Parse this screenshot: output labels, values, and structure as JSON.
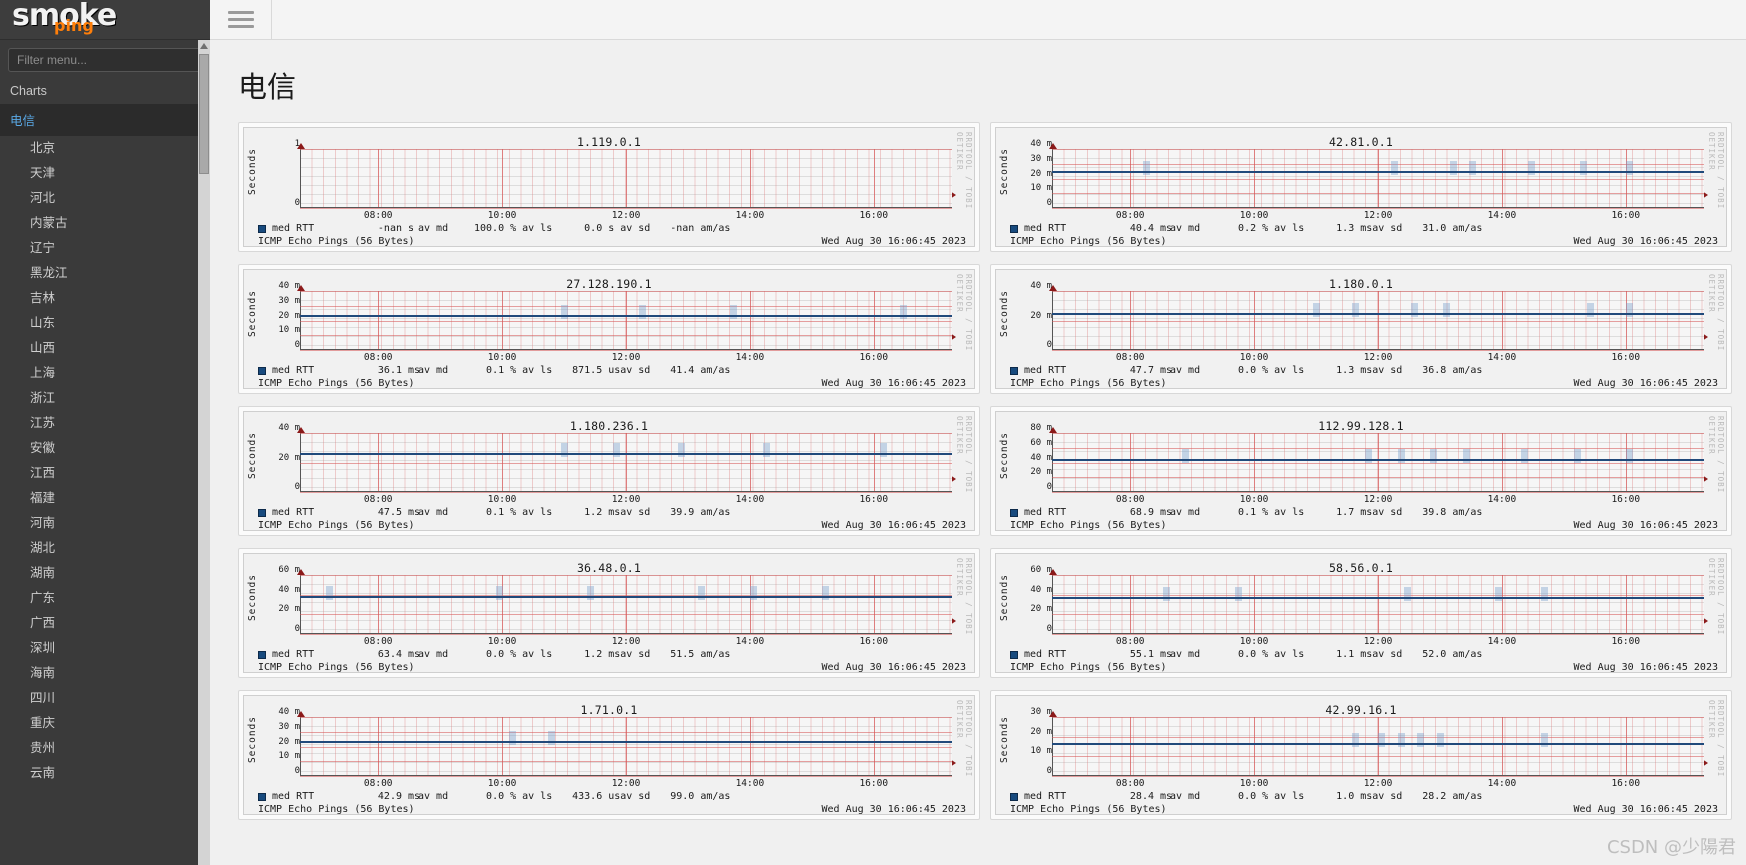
{
  "brand": {
    "smoke": "smoke",
    "ping": "ping"
  },
  "sidebar": {
    "filter_placeholder": "Filter menu...",
    "section_label": "Charts",
    "root_label": "电信",
    "items": [
      {
        "label": "北京"
      },
      {
        "label": "天津"
      },
      {
        "label": "河北"
      },
      {
        "label": "内蒙古"
      },
      {
        "label": "辽宁"
      },
      {
        "label": "黑龙江"
      },
      {
        "label": "吉林"
      },
      {
        "label": "山东"
      },
      {
        "label": "山西"
      },
      {
        "label": "上海"
      },
      {
        "label": "浙江"
      },
      {
        "label": "江苏"
      },
      {
        "label": "安徽"
      },
      {
        "label": "江西"
      },
      {
        "label": "福建"
      },
      {
        "label": "河南"
      },
      {
        "label": "湖北"
      },
      {
        "label": "湖南"
      },
      {
        "label": "广东"
      },
      {
        "label": "广西"
      },
      {
        "label": "深圳"
      },
      {
        "label": "海南"
      },
      {
        "label": "四川"
      },
      {
        "label": "重庆"
      },
      {
        "label": "贵州"
      },
      {
        "label": "云南"
      }
    ]
  },
  "topbar": {
    "menu_icon": "hamburger-icon"
  },
  "page": {
    "title": "电信"
  },
  "common": {
    "yaxis_label": "Seconds",
    "watermark": "RRDTOOL / TOBI OETIKER",
    "xticks": [
      "08:00",
      "10:00",
      "12:00",
      "14:00",
      "16:00"
    ],
    "probe": "ICMP Echo Pings (56 Bytes)",
    "timestamp": "Wed Aug 30 16:06:45 2023",
    "legend_name": "med RTT",
    "legend_med_unit": "av md",
    "legend_loss_unit": "av ls",
    "legend_sd_unit": "av sd",
    "legend_am_unit": "am/as",
    "accent": "#174a7e",
    "grid_red": "#d65656"
  },
  "csdn_watermark": "CSDN @少陽君",
  "chart_data": [
    {
      "type": "line",
      "title": "1.119.0.1",
      "ylabel": "Seconds",
      "ytick_labels": [
        "1",
        "0"
      ],
      "ylim": [
        0,
        1
      ],
      "xlabel": "",
      "x_ticks": [
        "08:00",
        "10:00",
        "12:00",
        "14:00",
        "16:00"
      ],
      "series": [
        {
          "name": "med RTT",
          "values": []
        }
      ],
      "median": "-nan",
      "median_unit": "s",
      "loss": "100.0",
      "loss_unit": "%",
      "sd": "0.0",
      "sd_unit": "s",
      "am": "-nan",
      "probe": "ICMP Echo Pings (56 Bytes)",
      "timestamp": "Wed Aug 30 16:06:45 2023",
      "line_pct": null,
      "smokes": []
    },
    {
      "type": "line",
      "title": "42.81.0.1",
      "ylabel": "Seconds",
      "ytick_labels": [
        "40 m",
        "30 m",
        "20 m",
        "10 m",
        "0"
      ],
      "ylim": [
        0,
        50
      ],
      "xlabel": "",
      "x_ticks": [
        "08:00",
        "10:00",
        "12:00",
        "14:00",
        "16:00"
      ],
      "series": [
        {
          "name": "med RTT",
          "values": [
            40.4
          ]
        }
      ],
      "median": "40.4",
      "median_unit": "ms",
      "loss": "0.2",
      "loss_unit": "%",
      "sd": "1.3",
      "sd_unit": "ms",
      "am": "31.0",
      "probe": "ICMP Echo Pings (56 Bytes)",
      "timestamp": "Wed Aug 30 16:06:45 2023",
      "line_pct": 22,
      "smokes": [
        14,
        52,
        61,
        64,
        73,
        81,
        88
      ]
    },
    {
      "type": "line",
      "title": "27.128.190.1",
      "ylabel": "Seconds",
      "ytick_labels": [
        "40 m",
        "30 m",
        "20 m",
        "10 m",
        "0"
      ],
      "ylim": [
        0,
        50
      ],
      "xlabel": "",
      "x_ticks": [
        "08:00",
        "10:00",
        "12:00",
        "14:00",
        "16:00"
      ],
      "series": [
        {
          "name": "med RTT",
          "values": [
            36.1
          ]
        }
      ],
      "median": "36.1",
      "median_unit": "ms",
      "loss": "0.1",
      "loss_unit": "%",
      "sd": "871.5",
      "sd_unit": "us",
      "am": "41.4",
      "probe": "ICMP Echo Pings (56 Bytes)",
      "timestamp": "Wed Aug 30 16:06:45 2023",
      "line_pct": 24,
      "smokes": [
        40,
        52,
        66,
        92
      ]
    },
    {
      "type": "line",
      "title": "1.180.0.1",
      "ylabel": "Seconds",
      "ytick_labels": [
        "40 m",
        "20 m",
        "0"
      ],
      "ylim": [
        0,
        55
      ],
      "xlabel": "",
      "x_ticks": [
        "08:00",
        "10:00",
        "12:00",
        "14:00",
        "16:00"
      ],
      "series": [
        {
          "name": "med RTT",
          "values": [
            47.7
          ]
        }
      ],
      "median": "47.7",
      "median_unit": "ms",
      "loss": "0.0",
      "loss_unit": "%",
      "sd": "1.3",
      "sd_unit": "ms",
      "am": "36.8",
      "probe": "ICMP Echo Pings (56 Bytes)",
      "timestamp": "Wed Aug 30 16:06:45 2023",
      "line_pct": 22,
      "smokes": [
        40,
        46,
        55,
        60,
        82,
        88
      ]
    },
    {
      "type": "line",
      "title": "1.180.236.1",
      "ylabel": "Seconds",
      "ytick_labels": [
        "40 m",
        "20 m",
        "0"
      ],
      "ylim": [
        0,
        55
      ],
      "xlabel": "",
      "x_ticks": [
        "08:00",
        "10:00",
        "12:00",
        "14:00",
        "16:00"
      ],
      "series": [
        {
          "name": "med RTT",
          "values": [
            47.5
          ]
        }
      ],
      "median": "47.5",
      "median_unit": "ms",
      "loss": "0.1",
      "loss_unit": "%",
      "sd": "1.2",
      "sd_unit": "ms",
      "am": "39.9",
      "probe": "ICMP Echo Pings (56 Bytes)",
      "timestamp": "Wed Aug 30 16:06:45 2023",
      "line_pct": 20,
      "smokes": [
        40,
        48,
        58,
        71,
        89
      ]
    },
    {
      "type": "line",
      "title": "112.99.128.1",
      "ylabel": "Seconds",
      "ytick_labels": [
        "80 m",
        "60 m",
        "40 m",
        "20 m",
        "0"
      ],
      "ylim": [
        0,
        90
      ],
      "xlabel": "",
      "x_ticks": [
        "08:00",
        "10:00",
        "12:00",
        "14:00",
        "16:00"
      ],
      "series": [
        {
          "name": "med RTT",
          "values": [
            68.9
          ]
        }
      ],
      "median": "68.9",
      "median_unit": "ms",
      "loss": "0.1",
      "loss_unit": "%",
      "sd": "1.7",
      "sd_unit": "ms",
      "am": "39.8",
      "probe": "ICMP Echo Pings (56 Bytes)",
      "timestamp": "Wed Aug 30 16:06:45 2023",
      "line_pct": 26,
      "smokes": [
        20,
        48,
        53,
        58,
        63,
        72,
        80,
        88
      ]
    },
    {
      "type": "line",
      "title": "36.48.0.1",
      "ylabel": "Seconds",
      "ytick_labels": [
        "60 m",
        "40 m",
        "20 m",
        "0"
      ],
      "ylim": [
        0,
        70
      ],
      "xlabel": "",
      "x_ticks": [
        "08:00",
        "10:00",
        "12:00",
        "14:00",
        "16:00"
      ],
      "series": [
        {
          "name": "med RTT",
          "values": [
            63.4
          ]
        }
      ],
      "median": "63.4",
      "median_unit": "ms",
      "loss": "0.0",
      "loss_unit": "%",
      "sd": "1.2",
      "sd_unit": "ms",
      "am": "51.5",
      "probe": "ICMP Echo Pings (56 Bytes)",
      "timestamp": "Wed Aug 30 16:06:45 2023",
      "line_pct": 21,
      "smokes": [
        4,
        30,
        44,
        61,
        69,
        80
      ]
    },
    {
      "type": "line",
      "title": "58.56.0.1",
      "ylabel": "Seconds",
      "ytick_labels": [
        "60 m",
        "40 m",
        "20 m",
        "0"
      ],
      "ylim": [
        0,
        70
      ],
      "xlabel": "",
      "x_ticks": [
        "08:00",
        "10:00",
        "12:00",
        "14:00",
        "16:00"
      ],
      "series": [
        {
          "name": "med RTT",
          "values": [
            55.1
          ]
        }
      ],
      "median": "55.1",
      "median_unit": "ms",
      "loss": "0.0",
      "loss_unit": "%",
      "sd": "1.1",
      "sd_unit": "ms",
      "am": "52.0",
      "probe": "ICMP Echo Pings (56 Bytes)",
      "timestamp": "Wed Aug 30 16:06:45 2023",
      "line_pct": 22,
      "smokes": [
        17,
        28,
        54,
        68,
        75
      ]
    },
    {
      "type": "line",
      "title": "1.71.0.1",
      "ylabel": "Seconds",
      "ytick_labels": [
        "40 m",
        "30 m",
        "20 m",
        "10 m",
        "0"
      ],
      "ylim": [
        0,
        50
      ],
      "xlabel": "",
      "x_ticks": [
        "08:00",
        "10:00",
        "12:00",
        "14:00",
        "16:00"
      ],
      "series": [
        {
          "name": "med RTT",
          "values": [
            42.9
          ]
        }
      ],
      "median": "42.9",
      "median_unit": "ms",
      "loss": "0.0",
      "loss_unit": "%",
      "sd": "433.6",
      "sd_unit": "us",
      "am": "99.0",
      "probe": "ICMP Echo Pings (56 Bytes)",
      "timestamp": "Wed Aug 30 16:06:45 2023",
      "line_pct": 24,
      "smokes": [
        32,
        38
      ]
    },
    {
      "type": "line",
      "title": "42.99.16.1",
      "ylabel": "Seconds",
      "ytick_labels": [
        "30 m",
        "20 m",
        "10 m",
        "0"
      ],
      "ylim": [
        0,
        35
      ],
      "xlabel": "",
      "x_ticks": [
        "08:00",
        "10:00",
        "12:00",
        "14:00",
        "16:00"
      ],
      "series": [
        {
          "name": "med RTT",
          "values": [
            28.4
          ]
        }
      ],
      "median": "28.4",
      "median_unit": "ms",
      "loss": "0.0",
      "loss_unit": "%",
      "sd": "1.0",
      "sd_unit": "ms",
      "am": "28.2",
      "probe": "ICMP Echo Pings (56 Bytes)",
      "timestamp": "Wed Aug 30 16:06:45 2023",
      "line_pct": 26,
      "smokes": [
        46,
        50,
        53,
        56,
        59,
        75
      ]
    }
  ]
}
